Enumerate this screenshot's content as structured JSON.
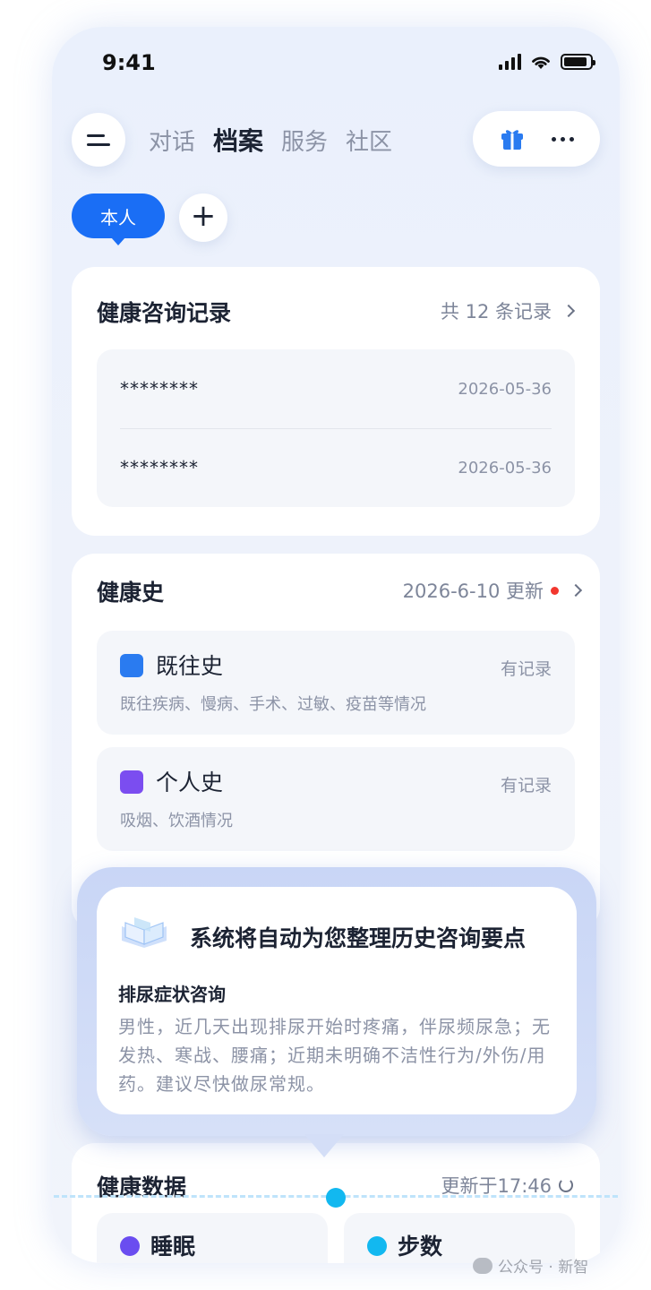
{
  "status_bar": {
    "time": "9:41",
    "battery_level": 0.9,
    "signal_bars": 4
  },
  "nav": {
    "tabs": [
      {
        "label": "对话",
        "active": false
      },
      {
        "label": "档案",
        "active": true
      },
      {
        "label": "服务",
        "active": false
      },
      {
        "label": "社区",
        "active": false
      }
    ],
    "icons": [
      "menu-icon",
      "gift-icon",
      "more-icon"
    ]
  },
  "profile": {
    "self_label": "本人",
    "add_label": "+"
  },
  "consult_records": {
    "title": "健康咨询记录",
    "summary": "共 12 条记录",
    "items": [
      {
        "masked": "********",
        "date": "2026-05-36"
      },
      {
        "masked": "********",
        "date": "2026-05-36"
      }
    ]
  },
  "health_history": {
    "title": "健康史",
    "updated": "2026-6-10 更新",
    "items": [
      {
        "name": "既往史",
        "status": "有记录",
        "desc": "既往疾病、慢病、手术、过敏、疫苗等情况",
        "icon": "clock-icon"
      },
      {
        "name": "个人史",
        "status": "有记录",
        "desc": "吸烟、饮酒情况",
        "icon": "person-icon"
      }
    ]
  },
  "popup": {
    "heading": "系统将自动为您整理历史咨询要点",
    "subtitle": "排尿症状咨询",
    "body": "男性，近几天出现排尿开始时疼痛，伴尿频尿急；无发热、寒战、腰痛；近期未明确不洁性行为/外伤/用药。建议尽快做尿常规。"
  },
  "health_data": {
    "title": "健康数据",
    "updated": "更新于17:46",
    "tiles": [
      {
        "label": "睡眠",
        "icon": "moon-icon"
      },
      {
        "label": "步数",
        "icon": "shoe-icon"
      }
    ]
  },
  "watermark": "公众号 · 新智"
}
